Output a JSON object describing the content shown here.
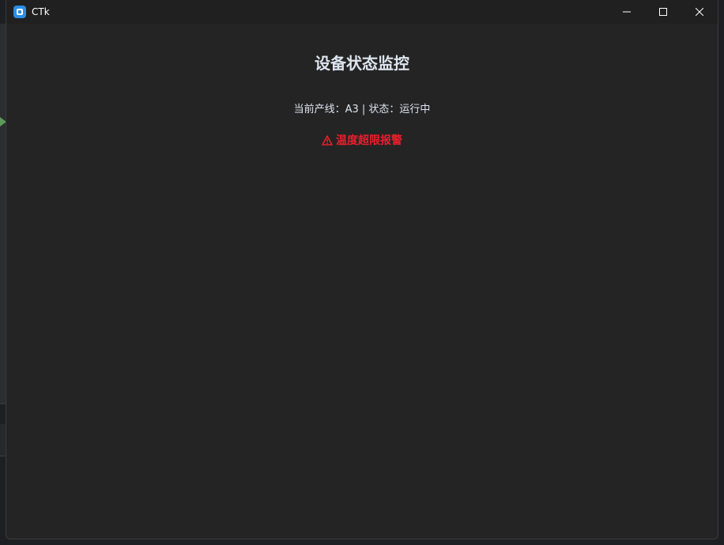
{
  "window": {
    "title": "CTk",
    "app_icon": "ctk-app-icon",
    "controls": [
      "minimize-icon",
      "maximize-icon",
      "close-icon"
    ]
  },
  "main": {
    "heading": "设备状态监控",
    "status_line": "当前产线：A3 | 状态：运行中",
    "alarm_icon": "warning-triangle-icon",
    "alarm_text": "温度超限报警"
  },
  "colors": {
    "window_bg": "#242424",
    "titlebar_bg": "#202020",
    "text": "#dce4ee",
    "alarm": "#e8202a",
    "app_icon": "#2b8ee6"
  }
}
